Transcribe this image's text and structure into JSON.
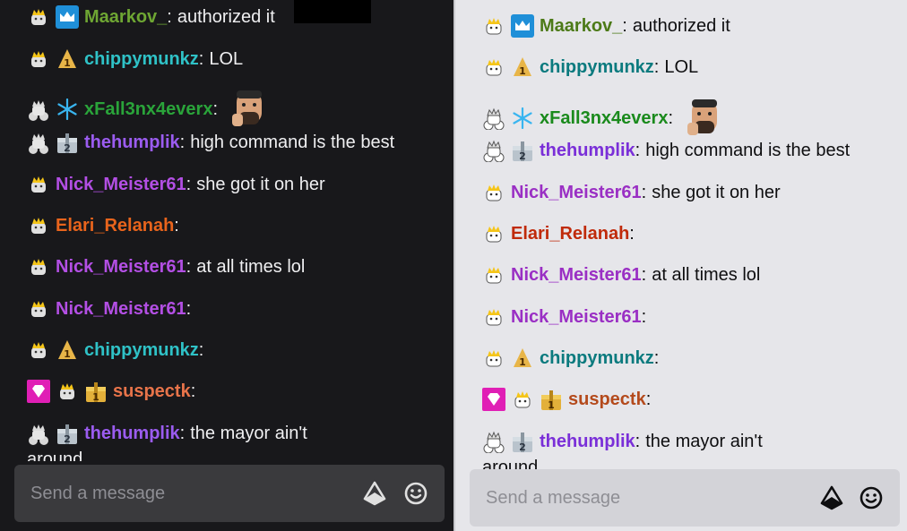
{
  "colors": {
    "dark_bg": "#18181b",
    "light_bg": "#e6e6ea",
    "dark_input_bg": "#3a3a3d",
    "light_input_bg": "#d3d3d8"
  },
  "input": {
    "placeholder": "Send a message"
  },
  "dark": {
    "messages": [
      {
        "user": "Maarkov_",
        "text": "authorized it",
        "color": "#6ea633"
      },
      {
        "user": "chippymunkz",
        "text": "LOL",
        "color": "#2fc2c7"
      },
      {
        "user": "xFall3nx4everx",
        "text": "",
        "color": "#2aa43a"
      },
      {
        "user": "thehumplik",
        "text": "high command is the best",
        "color": "#9b5cf0"
      },
      {
        "user": "Nick_Meister61",
        "text": "she got it on her",
        "color": "#b34fe4"
      },
      {
        "user": "Elari_Relanah",
        "text": "",
        "color": "#e8641c"
      },
      {
        "user": "Nick_Meister61",
        "text": "at all times lol",
        "color": "#b34fe4"
      },
      {
        "user": "Nick_Meister61",
        "text": "",
        "color": "#b34fe4"
      },
      {
        "user": "chippymunkz",
        "text": "",
        "color": "#2fc2c7"
      },
      {
        "user": "suspectk",
        "text": "",
        "color": "#e8744a"
      },
      {
        "user": "thehumplik",
        "text": "the mayor ain't",
        "color": "#9b5cf0"
      }
    ],
    "wrap_text": "around"
  },
  "light": {
    "messages": [
      {
        "user": "Maarkov_",
        "text": "authorized it",
        "color": "#4c7a18"
      },
      {
        "user": "chippymunkz",
        "text": "LOL",
        "color": "#0b7a7e"
      },
      {
        "user": "xFall3nx4everx",
        "text": "",
        "color": "#1a8a1c"
      },
      {
        "user": "thehumplik",
        "text": "high command is the best",
        "color": "#7a2fd8"
      },
      {
        "user": "Nick_Meister61",
        "text": "she got it on her",
        "color": "#9a2fc4"
      },
      {
        "user": "Elari_Relanah",
        "text": "",
        "color": "#c02a0a"
      },
      {
        "user": "Nick_Meister61",
        "text": "at all times lol",
        "color": "#9a2fc4"
      },
      {
        "user": "Nick_Meister61",
        "text": "",
        "color": "#9a2fc4"
      },
      {
        "user": "chippymunkz",
        "text": "",
        "color": "#0b7a7e"
      },
      {
        "user": "suspectk",
        "text": "",
        "color": "#b44a1c"
      },
      {
        "user": "thehumplik",
        "text": "the mayor ain't",
        "color": "#7a2fd8"
      }
    ],
    "wrap_text": "around"
  }
}
